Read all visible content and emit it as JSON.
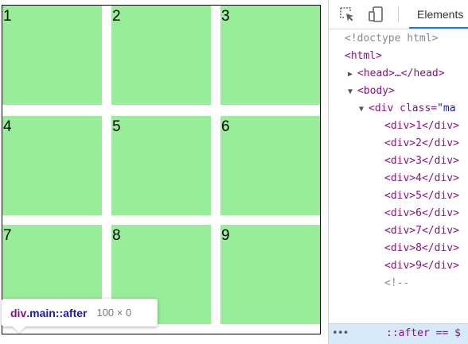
{
  "grid": {
    "cells": [
      "1",
      "2",
      "3",
      "4",
      "5",
      "6",
      "7",
      "8",
      "9"
    ],
    "cell_color": "#98ee98"
  },
  "tooltip": {
    "tag": "div",
    "selector": ".main::after",
    "size": "100 × 0"
  },
  "devtools": {
    "tab_label": "Elements",
    "tree": {
      "doctype": "<!doctype html>",
      "html_open": "<html>",
      "head": "<head>…</head>",
      "body_open": "<body>",
      "div_open": "<div class=\"ma",
      "div_tag": "<div class=",
      "div_value": "\"ma",
      "children": [
        "<div>1</div>",
        "<div>2</div>",
        "<div>3</div>",
        "<div>4</div>",
        "<div>5</div>",
        "<div>6</div>",
        "<div>7</div>",
        "<div>8</div>",
        "<div>9</div>"
      ],
      "comment": "<!--"
    },
    "bottom": {
      "dots": "•••",
      "selected": "::after == $"
    }
  }
}
